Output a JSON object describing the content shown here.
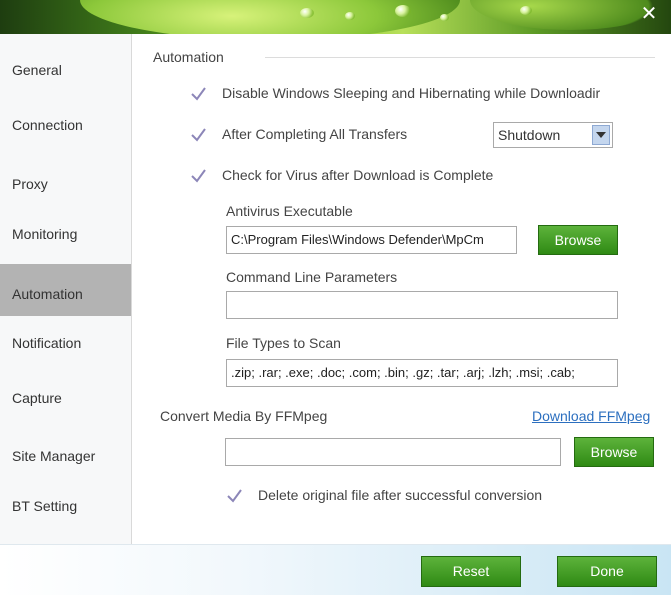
{
  "window": {
    "close_glyph": "✕"
  },
  "sidebar": {
    "items": [
      {
        "label": "General"
      },
      {
        "label": "Connection"
      },
      {
        "label": "Proxy"
      },
      {
        "label": "Monitoring"
      },
      {
        "label": "Automation",
        "active": true
      },
      {
        "label": "Notification"
      },
      {
        "label": "Capture"
      },
      {
        "label": "Site Manager"
      },
      {
        "label": "BT Setting"
      }
    ]
  },
  "automation": {
    "section_title": "Automation",
    "disable_sleep_label": "Disable Windows Sleeping and Hibernating while Downloadir",
    "disable_sleep_checked": true,
    "after_transfers_label": "After Completing All Transfers",
    "after_transfers_checked": true,
    "after_transfers_action": "Shutdown",
    "virus_check_label": "Check for Virus after Download is Complete",
    "virus_check_checked": true,
    "antivirus_label": "Antivirus Executable",
    "antivirus_value": "C:\\Program Files\\Windows Defender\\MpCm",
    "browse_label": "Browse",
    "cmd_params_label": "Command Line Parameters",
    "cmd_params_value": "",
    "file_types_label": "File Types to Scan",
    "file_types_value": ".zip; .rar; .exe; .doc; .com; .bin; .gz; .tar; .arj; .lzh; .msi; .cab;"
  },
  "ffmpeg": {
    "label": "Convert Media By FFMpeg",
    "download_link": "Download FFMpeg",
    "path_value": "",
    "browse_label": "Browse",
    "delete_original_label": "Delete original file after successful conversion",
    "delete_original_checked": true
  },
  "footer": {
    "reset_label": "Reset",
    "done_label": "Done"
  },
  "colors": {
    "accent_green": "#3f9a1f",
    "active_nav": "#b3b3b3",
    "link_blue": "#2c6fbf",
    "check_purple": "#8c86b8"
  }
}
